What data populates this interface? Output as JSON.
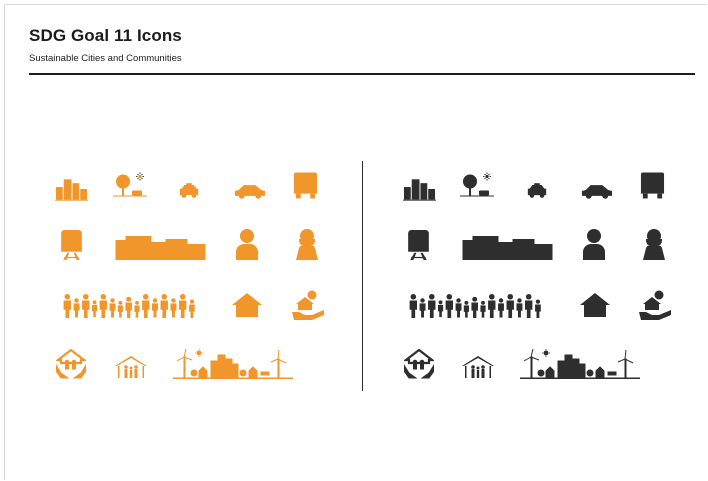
{
  "header": {
    "title": "SDG Goal 11 Icons",
    "subtitle": "Sustainable Cities and Communities"
  },
  "icon_sets": [
    {
      "name": "orange",
      "color": "#f0962b",
      "icons": [
        "city-buildings-icon",
        "park-tree-icon",
        "taxi-icon",
        "car-icon",
        "bus-icon",
        "train-icon",
        "slum-housing-icon",
        "man-icon",
        "woman-icon",
        "crowd-people-icon",
        "house-icon",
        "house-money-hand-icon",
        "hands-house-family-icon",
        "shelter-family-icon",
        "sustainable-city-icon"
      ]
    },
    {
      "name": "dark",
      "color": "#2e2e2e",
      "icons": [
        "city-buildings-icon",
        "park-tree-icon",
        "taxi-icon",
        "car-icon",
        "bus-icon",
        "train-icon",
        "slum-housing-icon",
        "man-icon",
        "woman-icon",
        "crowd-people-icon",
        "house-icon",
        "house-money-hand-icon",
        "hands-house-family-icon",
        "shelter-family-icon",
        "sustainable-city-icon"
      ]
    }
  ]
}
